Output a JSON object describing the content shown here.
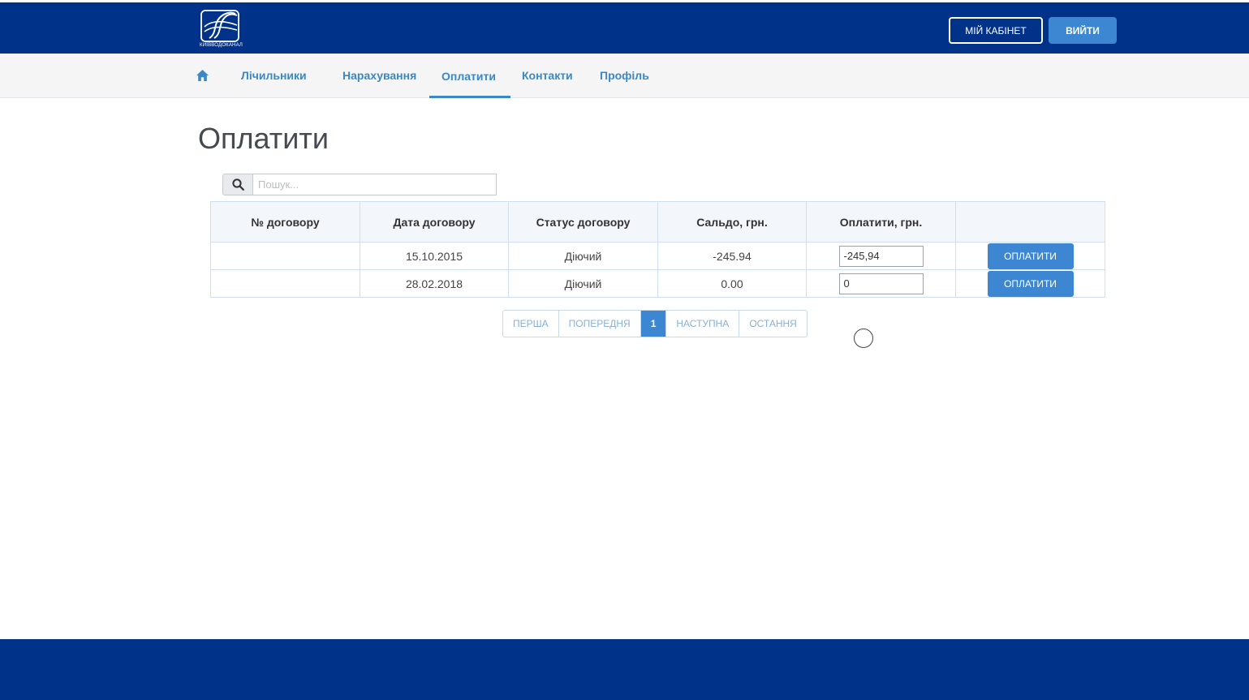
{
  "header": {
    "logo_text": "КИЇВВОДОКАНАЛ",
    "cabinet_label": "МІЙ КАБІНЕТ",
    "exit_label": "ВИЙТИ"
  },
  "nav": {
    "home_icon": "home-icon",
    "items": [
      {
        "label": "Лічильники"
      },
      {
        "label": "Нарахування"
      },
      {
        "label": "Оплатити",
        "active": true
      },
      {
        "label": "Контакти"
      },
      {
        "label": "Профіль"
      }
    ]
  },
  "page": {
    "title": "Оплатити"
  },
  "search": {
    "placeholder": "Пошук...",
    "value": "",
    "icon": "search-icon"
  },
  "table": {
    "columns": [
      "№ договору",
      "Дата договору",
      "Статус договору",
      "Сальдо, грн.",
      "Оплатити, грн.",
      ""
    ],
    "rows": [
      {
        "number": "",
        "date": "15.10.2015",
        "status": "Діючий",
        "saldo": "-245.94",
        "pay_value": "-245,94",
        "pay_label": "ОПЛАТИТИ"
      },
      {
        "number": "",
        "date": "28.02.2018",
        "status": "Діючий",
        "saldo": "0.00",
        "pay_value": "0",
        "pay_label": "ОПЛАТИТИ"
      }
    ]
  },
  "pagination": {
    "first": "ПЕРША",
    "prev": "ПОПЕРЕДНЯ",
    "current": "1",
    "next": "НАСТУПНА",
    "last": "ОСТАННЯ"
  },
  "colors": {
    "header_bg": "#00328a",
    "accent": "#3d87d2",
    "nav_text": "#3a88c6"
  }
}
